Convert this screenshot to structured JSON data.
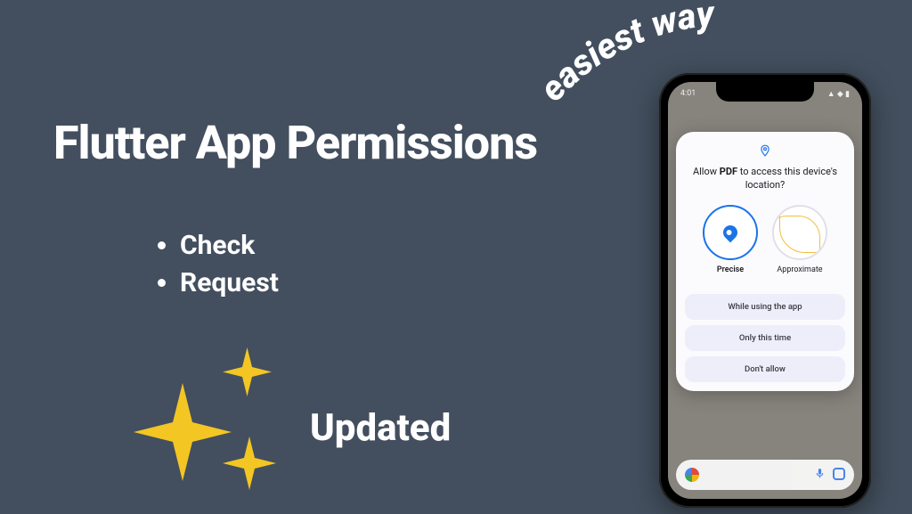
{
  "title": "Flutter App Permissions",
  "bullets": [
    "Check",
    "Request"
  ],
  "updated_label": "Updated",
  "arc_text": "easiest way",
  "phone": {
    "status_time": "4:01",
    "dialog": {
      "prompt_pre": "Allow ",
      "prompt_app": "PDF",
      "prompt_post": " to access this device's location?",
      "choice_precise": "Precise",
      "choice_approx": "Approximate",
      "btn_while": "While using the app",
      "btn_once": "Only this time",
      "btn_deny": "Don't allow"
    }
  }
}
